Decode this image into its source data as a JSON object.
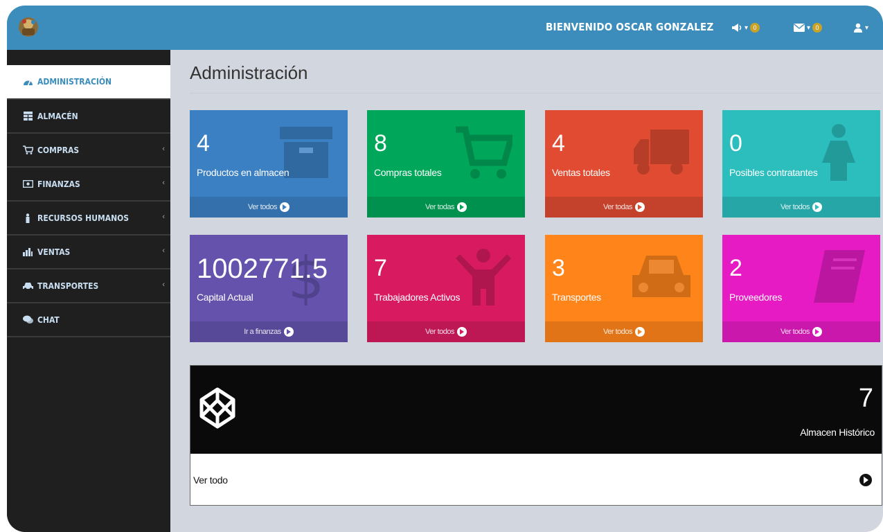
{
  "header": {
    "welcome": "BIENVENIDO OSCAR GONZALEZ",
    "notifications_count": "0",
    "messages_count": "0"
  },
  "sidebar": {
    "items": [
      {
        "label": "ADMINISTRACIÓN",
        "icon": "tachometer-icon"
      },
      {
        "label": "ALMACÉN",
        "icon": "table-icon"
      },
      {
        "label": "COMPRAS",
        "icon": "cart-icon"
      },
      {
        "label": "FINANZAS",
        "icon": "money-icon"
      },
      {
        "label": "RECURSOS HUMANOS",
        "icon": "person-icon"
      },
      {
        "label": "VENTAS",
        "icon": "chart-icon"
      },
      {
        "label": "TRANSPORTES",
        "icon": "car-icon"
      },
      {
        "label": "CHAT",
        "icon": "comments-icon"
      }
    ]
  },
  "page": {
    "title": "Administración"
  },
  "tiles": [
    {
      "value": "4",
      "label": "Productos en almacen",
      "link": "Ver todos",
      "color": "#3c80c4",
      "icon": "archive-icon"
    },
    {
      "value": "8",
      "label": "Compras totales",
      "link": "Ver todas",
      "color": "#00a65a",
      "icon": "cart-icon"
    },
    {
      "value": "4",
      "label": "Ventas totales",
      "link": "Ver todas",
      "color": "#e04b32",
      "icon": "truck-icon"
    },
    {
      "value": "0",
      "label": "Posibles contratantes",
      "link": "Ver todos",
      "color": "#2cbdbd",
      "icon": "female-icon"
    },
    {
      "value": "1002771.5",
      "label": "Capital Actual",
      "link": "Ir a finanzas",
      "color": "#6452ad",
      "icon": "dollar-icon"
    },
    {
      "value": "7",
      "label": "Trabajadores Activos",
      "link": "Ver todos",
      "color": "#d81b60",
      "icon": "child-icon"
    },
    {
      "value": "3",
      "label": "Transportes",
      "link": "Ver todos",
      "color": "#ff851b",
      "icon": "car-icon"
    },
    {
      "value": "2",
      "label": "Proveedores",
      "link": "Ver todos",
      "color": "#e61bc4",
      "icon": "book-icon"
    }
  ],
  "historic": {
    "value": "7",
    "label": "Almacen Histórico",
    "link": "Ver todo",
    "icon": "codepen-icon"
  }
}
